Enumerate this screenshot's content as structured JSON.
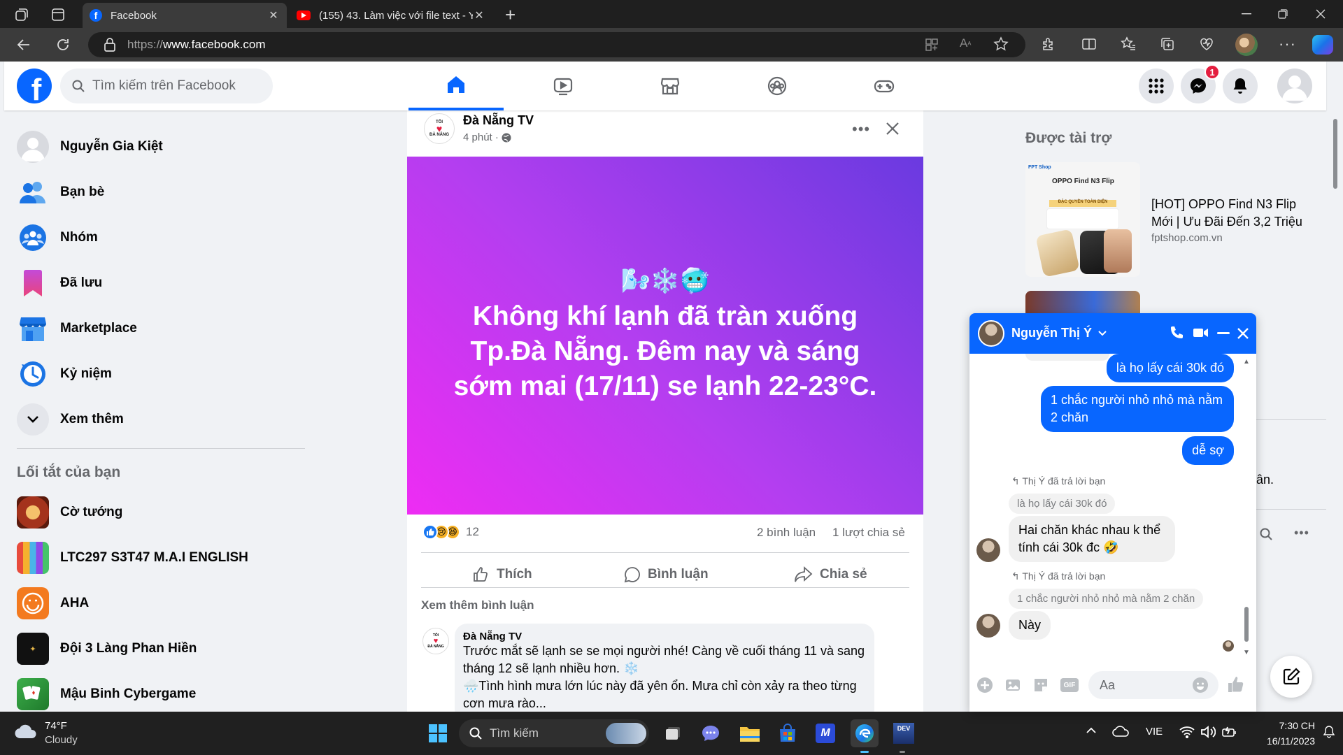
{
  "browser": {
    "tabs": [
      {
        "title": "Facebook",
        "active": true
      },
      {
        "title": "(155) 43. Làm việc với file text - Y",
        "active": false
      }
    ],
    "url_protocol": "https://",
    "url_host": "www.facebook.com"
  },
  "header": {
    "logo": "f",
    "search_placeholder": "Tìm kiếm trên Facebook",
    "messenger_badge": "1",
    "accent": "#0866ff"
  },
  "sidebar": {
    "items": [
      {
        "label": "Nguyễn Gia Kiệt",
        "icon": "avatar"
      },
      {
        "label": "Bạn bè",
        "icon": "friends-icon"
      },
      {
        "label": "Nhóm",
        "icon": "groups-icon"
      },
      {
        "label": "Đã lưu",
        "icon": "saved-icon"
      },
      {
        "label": "Marketplace",
        "icon": "marketplace-icon"
      },
      {
        "label": "Kỷ niệm",
        "icon": "memories-icon"
      },
      {
        "label": "Xem thêm",
        "icon": "chevron-down-icon"
      }
    ],
    "shortcuts_title": "Lối tắt của bạn",
    "shortcuts": [
      {
        "label": "Cờ tướng"
      },
      {
        "label": "LTC297 S3T47 M.A.I ENGLISH"
      },
      {
        "label": "AHA"
      },
      {
        "label": "Đội 3 Làng Phan Hiền"
      },
      {
        "label": "Mậu Binh Cybergame"
      }
    ]
  },
  "post": {
    "page_name": "Đà Nẵng TV",
    "page_logo_text": [
      "TÔI",
      "ĐÀ NẴNG"
    ],
    "time": "4 phút ·",
    "emoji": "🌬️❄️🥶",
    "text": "Không khí lạnh đã tràn xuống Tp.Đà Nẵng. Đêm nay và sáng sớm mai (17/11) se lạnh 22-23°C.",
    "reaction_count": "12",
    "comments": "2 bình luận",
    "shares": "1 lượt chia sẻ",
    "actions": {
      "like": "Thích",
      "comment": "Bình luận",
      "share": "Chia sẻ"
    },
    "more_comments": "Xem thêm bình luận",
    "comment": {
      "author": "Đà Nẵng TV",
      "line1": "Trước mắt sẽ lạnh se se mọi người nhé! Càng về cuối tháng 11 và sang",
      "line2": "tháng 12 sẽ lạnh nhiều hơn. ❄️",
      "line3": "🌧️Tình hình mưa lớn lúc này đã yên ổn. Mưa chỉ còn xảy ra theo từng",
      "line4": "cơn mưa rào..."
    }
  },
  "right": {
    "sponsored": "Được tài trợ",
    "ad_title": "[HOT] OPPO Find N3 Flip Mới | Ưu Đãi Đến 3,2 Triệu",
    "ad_domain": "fptshop.com.vn",
    "ad_image": {
      "brand": "FPT Shop",
      "model": "OPPO Find N3 Flip",
      "banner": "ĐẶC QUYỀN TOÀN DIỆN"
    },
    "peek_text": "ân."
  },
  "chat": {
    "name": "Nguyễn Thị Ý",
    "messages_out": [
      "là họ lấy cái 30k đó",
      "1 chắc người nhỏ nhỏ mà nằm 2 chăn",
      "dễ sợ"
    ],
    "replied_label": "Thị Ý đã trả lời bạn",
    "quote1": "là họ lấy cái 30k đó",
    "reply1": "Hai chăn khác nhau k thể tính cái 30k đc 🤣",
    "quote2": "1 chắc người nhỏ nhỏ mà nằm 2 chăn",
    "reply2": "Này",
    "input_placeholder": "Aa"
  },
  "taskbar": {
    "weather_temp": "74°F",
    "weather_text": "Cloudy",
    "search": "Tìm kiếm",
    "lang": "VIE",
    "time": "7:30 CH",
    "date": "16/11/2023"
  }
}
